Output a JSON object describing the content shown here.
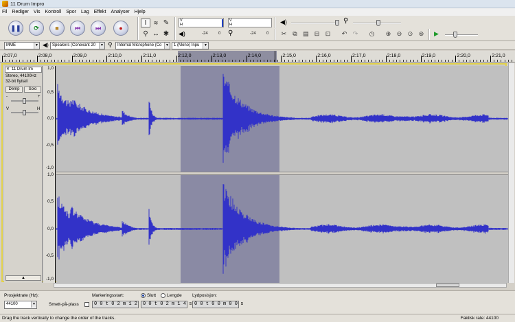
{
  "window": {
    "title": "11 Drum Impro"
  },
  "menu": [
    "Fil",
    "Rediger",
    "Vis",
    "Kontroll",
    "Spor",
    "Lag",
    "Effekt",
    "Analyser",
    "Hjelp"
  ],
  "transport": {
    "pause_icon": "pause-icon",
    "play_icon": "play-icon",
    "stop_icon": "stop-icon",
    "skip_start_icon": "skip-to-start-icon",
    "skip_end_icon": "skip-to-end-icon",
    "record_icon": "record-icon"
  },
  "meters": {
    "left_channel": "V",
    "right_channel": "H",
    "scale_low": "-24",
    "scale_zero": "0"
  },
  "device": {
    "host": "MME",
    "output": "Speakers (Conexant 20",
    "input": "Internal Microphone (Co",
    "channels": "1 (Mono) Inpu"
  },
  "ruler": {
    "labels": [
      "2:07,0",
      "2:08,0",
      "2:09,0",
      "2:10,0",
      "2:11,0",
      "2:12,0",
      "2:13,0",
      "2:14,0",
      "2:15,0",
      "2:16,0",
      "2:17,0",
      "2:18,0",
      "2:19,0",
      "2:20,0",
      "2:21,0"
    ]
  },
  "track": {
    "name": "11 Drum Im",
    "format": "Stereo, 44100Hz",
    "bitdepth": "32-bit flyttall",
    "mute_label": "Demp",
    "solo_label": "Solo",
    "gain_minus": "-",
    "gain_plus": "+",
    "pan_left": "V",
    "pan_right": "H",
    "collapse_icon": "collapse-arrow-icon",
    "amplitude_labels": [
      "1,0",
      "0,5",
      "0,0",
      "-0,5",
      "-1,0"
    ]
  },
  "selection_bar": {
    "rate_label": "Prosjektrate (Hz):",
    "rate_value": "44100",
    "snap_label": "Smett-på-plass",
    "start_label": "Markeringsstart:",
    "start_value": "0 0 t 0 2 m 1 2 s",
    "end_option": "Slutt",
    "length_option": "Lengde",
    "end_value": "0 0 t 0 2 m 1 4 s",
    "pos_label": "Lydposisjon:",
    "pos_value": "0 0 t 0 0 m 0 0 s"
  },
  "status": {
    "hint": "Drag the track vertically to change the order of the tracks.",
    "rate": "Faktisk rate: 44100"
  },
  "colors": {
    "waveform": "#3232c8",
    "selection": "#8a8aa4",
    "track_border": "#e3d24a"
  }
}
